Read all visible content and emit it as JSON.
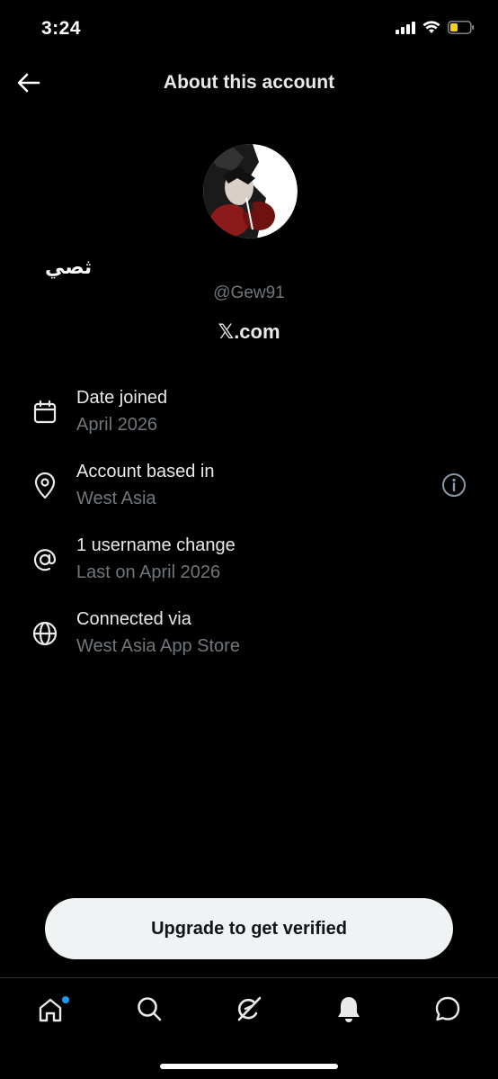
{
  "status_bar": {
    "time": "3:24",
    "icons": [
      "cellular-signal-icon",
      "wifi-icon",
      "battery-low-icon"
    ],
    "battery_color": "#f5d020"
  },
  "header": {
    "title": "About this account",
    "back_icon": "arrow-left-icon"
  },
  "profile": {
    "display_name": "ثصي",
    "handle": "@Gew91",
    "domain_logo": "𝕏",
    "domain_suffix": ".com"
  },
  "info_rows": [
    {
      "icon": "calendar-icon",
      "title": "Date joined",
      "subtitle": "April 2026"
    },
    {
      "icon": "location-pin-icon",
      "title": "Account based in",
      "subtitle": "West Asia",
      "help_icon": "info-circle-icon"
    },
    {
      "icon": "at-sign-icon",
      "title": "1 username change",
      "subtitle": "Last on April 2026"
    },
    {
      "icon": "globe-icon",
      "title": "Connected via",
      "subtitle": "West Asia App Store"
    }
  ],
  "upgrade_button": {
    "label": "Upgrade to get verified"
  },
  "tab_bar": {
    "tabs": [
      {
        "name": "home",
        "icon": "home-icon",
        "has_notification_dot": true
      },
      {
        "name": "search",
        "icon": "search-icon"
      },
      {
        "name": "grok",
        "icon": "grok-icon"
      },
      {
        "name": "notifications",
        "icon": "bell-icon"
      },
      {
        "name": "messages",
        "icon": "chat-bubble-icon"
      }
    ]
  },
  "colors": {
    "background": "#000000",
    "primary_text": "#e7e9ea",
    "secondary_text": "#71767b",
    "accent": "#1d9bf0",
    "button_bg": "#eff3f4"
  }
}
